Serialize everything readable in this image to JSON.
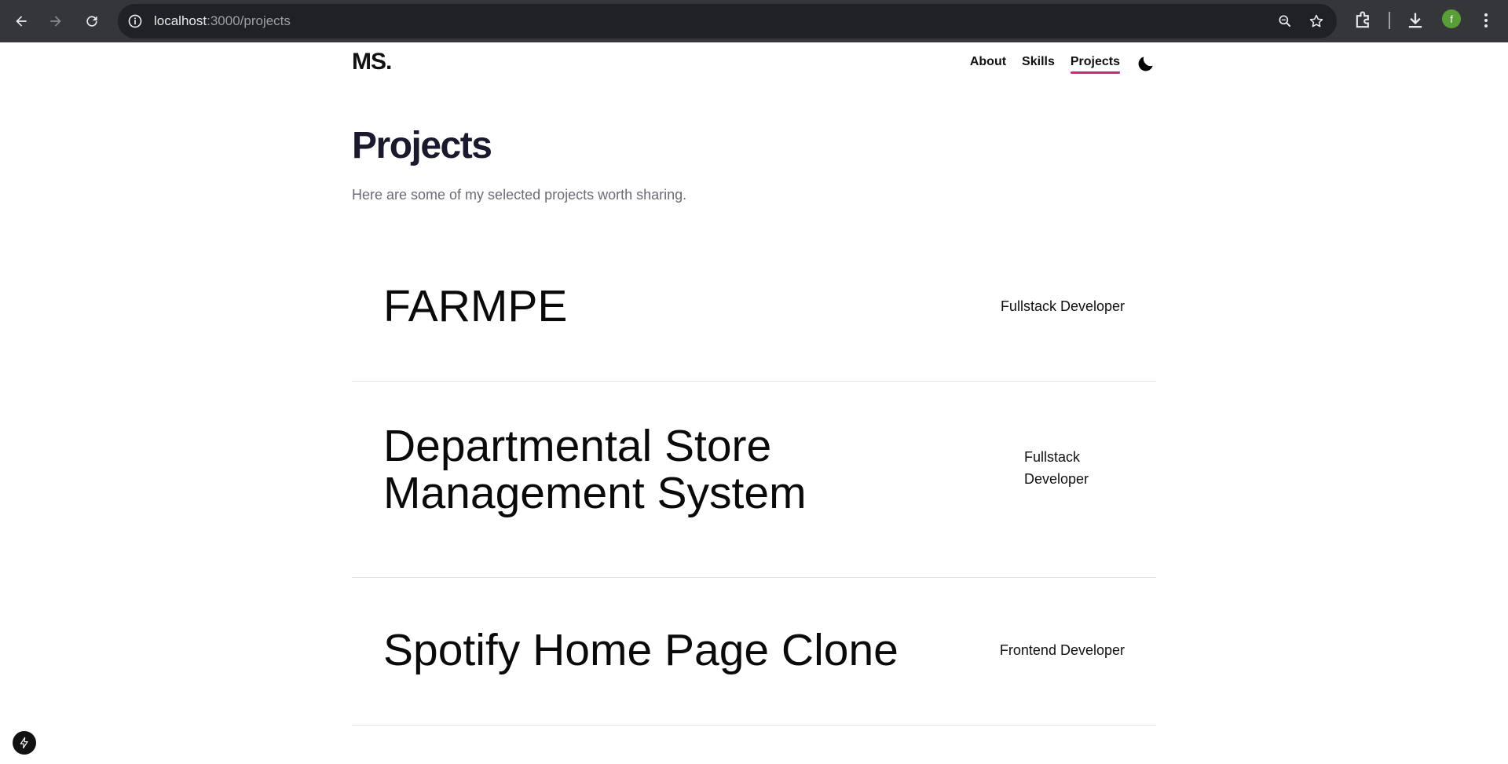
{
  "browser": {
    "url_host": "localhost",
    "url_path": ":3000/projects",
    "avatar_letter": "f"
  },
  "header": {
    "logo": "MS.",
    "nav": [
      {
        "label": "About"
      },
      {
        "label": "Skills"
      },
      {
        "label": "Projects",
        "active": true
      }
    ],
    "theme_icon": "moon-icon"
  },
  "page": {
    "title": "Projects",
    "subtitle": "Here are some of my selected projects worth sharing."
  },
  "projects": [
    {
      "name": "FARMPE",
      "role": "Fullstack Developer"
    },
    {
      "name": "Departmental Store Management System",
      "role": "Fullstack Developer"
    },
    {
      "name": "Spotify Home Page Clone",
      "role": "Frontend Developer"
    }
  ],
  "colors": {
    "accent": "#d6247a",
    "title": "#1a1a2e",
    "muted": "#6b6b78"
  }
}
